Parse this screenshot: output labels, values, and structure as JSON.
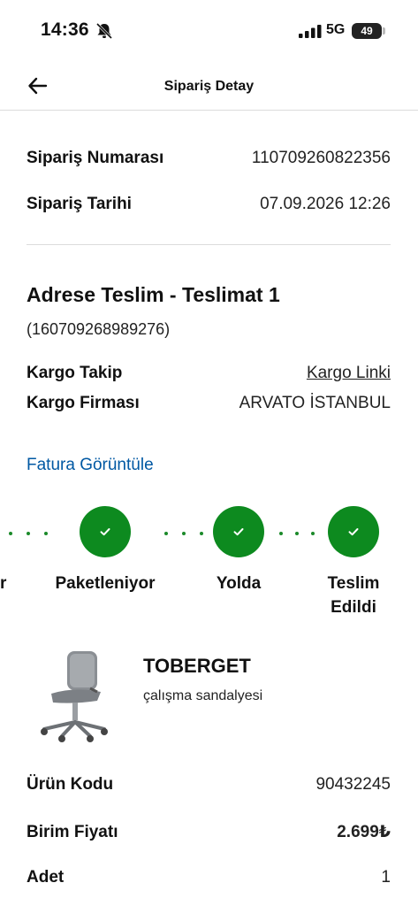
{
  "status_bar": {
    "time": "14:36",
    "network": "5G",
    "battery": "49",
    "icons": [
      "bell-slash-icon",
      "signal-icon",
      "battery-icon"
    ]
  },
  "nav": {
    "back_icon": "arrow-left-icon",
    "title": "Sipariş Detay"
  },
  "order": {
    "number_label": "Sipariş Numarası",
    "number_value": "110709260822356",
    "date_label": "Sipariş Tarihi",
    "date_value": "07.09.2026 12:26"
  },
  "delivery": {
    "title": "Adrese Teslim - Teslimat 1",
    "id": "(160709268989276)",
    "tracking_label": "Kargo Takip",
    "tracking_link": "Kargo Linki",
    "carrier_label": "Kargo Firması",
    "carrier_value": "ARVATO İSTANBUL",
    "invoice_link": "Fatura Görüntüle"
  },
  "progress": {
    "color": "#0d8a1f",
    "partial_left_label": "r",
    "steps": [
      {
        "label": "Paketleniyor",
        "done": true
      },
      {
        "label": "Yolda",
        "done": true
      },
      {
        "label_line1": "Teslim",
        "label_line2": "Edildi",
        "done": true
      }
    ]
  },
  "product": {
    "name": "TOBERGET",
    "description": "çalışma sandalyesi",
    "image_icon": "office-chair-image",
    "code_label": "Ürün Kodu",
    "code_value": "90432245",
    "price_label": "Birim Fiyatı",
    "price_value": "2.699₺",
    "qty_label": "Adet",
    "qty_value": "1"
  }
}
